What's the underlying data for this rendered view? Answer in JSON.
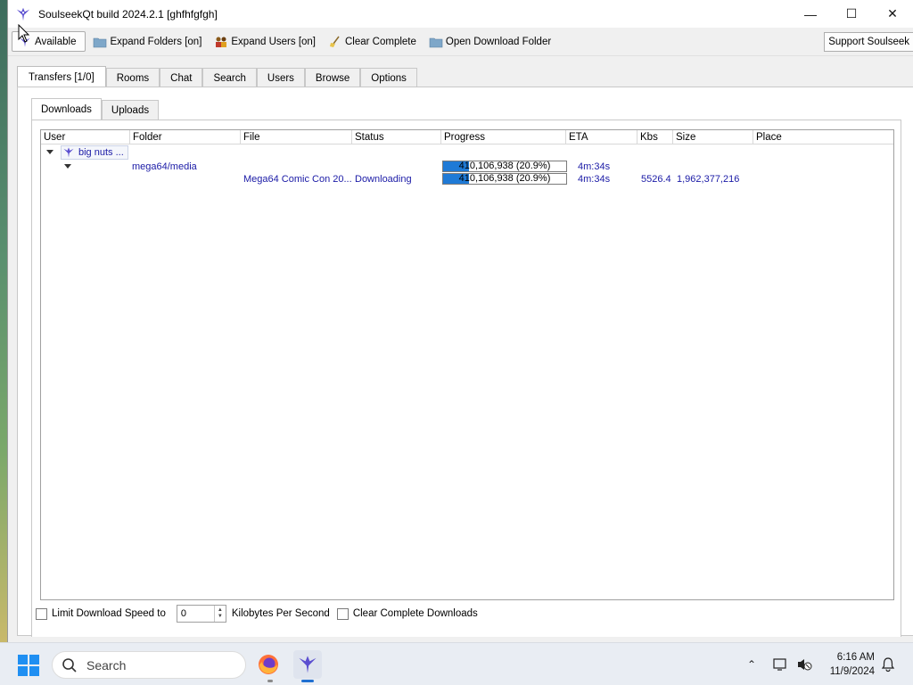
{
  "window": {
    "title": "SoulseekQt build 2024.2.1 [ghfhfgfgh]",
    "minimize": "—",
    "maximize": "☐",
    "close": "✕"
  },
  "toolbar": {
    "status_label": "Available",
    "expand_folders": "Expand Folders [on]",
    "expand_users": "Expand Users [on]",
    "clear_complete": "Clear Complete",
    "open_download_folder": "Open Download Folder",
    "support": "Support Soulseek"
  },
  "tabs": [
    "Transfers [1/0]",
    "Rooms",
    "Chat",
    "Search",
    "Users",
    "Browse",
    "Options"
  ],
  "subtabs": [
    "Downloads",
    "Uploads"
  ],
  "columns": [
    "User",
    "Folder",
    "File",
    "Status",
    "Progress",
    "ETA",
    "Kbs",
    "Size",
    "Place"
  ],
  "transfers": {
    "user": "big nuts ...",
    "folder": "mega64/media",
    "file": "Mega64 Comic Con 20...",
    "status": "Downloading",
    "progress_text": "410,106,938 (20.9%)",
    "progress_fraction": 0.209,
    "eta": "4m:34s",
    "kbs": "5526.4",
    "size": "1,962,377,216"
  },
  "bottom": {
    "limit_label": "Limit Download Speed to",
    "limit_value": "0",
    "unit_label": "Kilobytes Per Second",
    "clear_label": "Clear Complete Downloads"
  },
  "taskbar": {
    "search_placeholder": "Search",
    "time": "6:16 AM",
    "date": "11/9/2024"
  },
  "colors": {
    "accent": "#1f7ad6",
    "link_text": "#1a1aa6"
  }
}
